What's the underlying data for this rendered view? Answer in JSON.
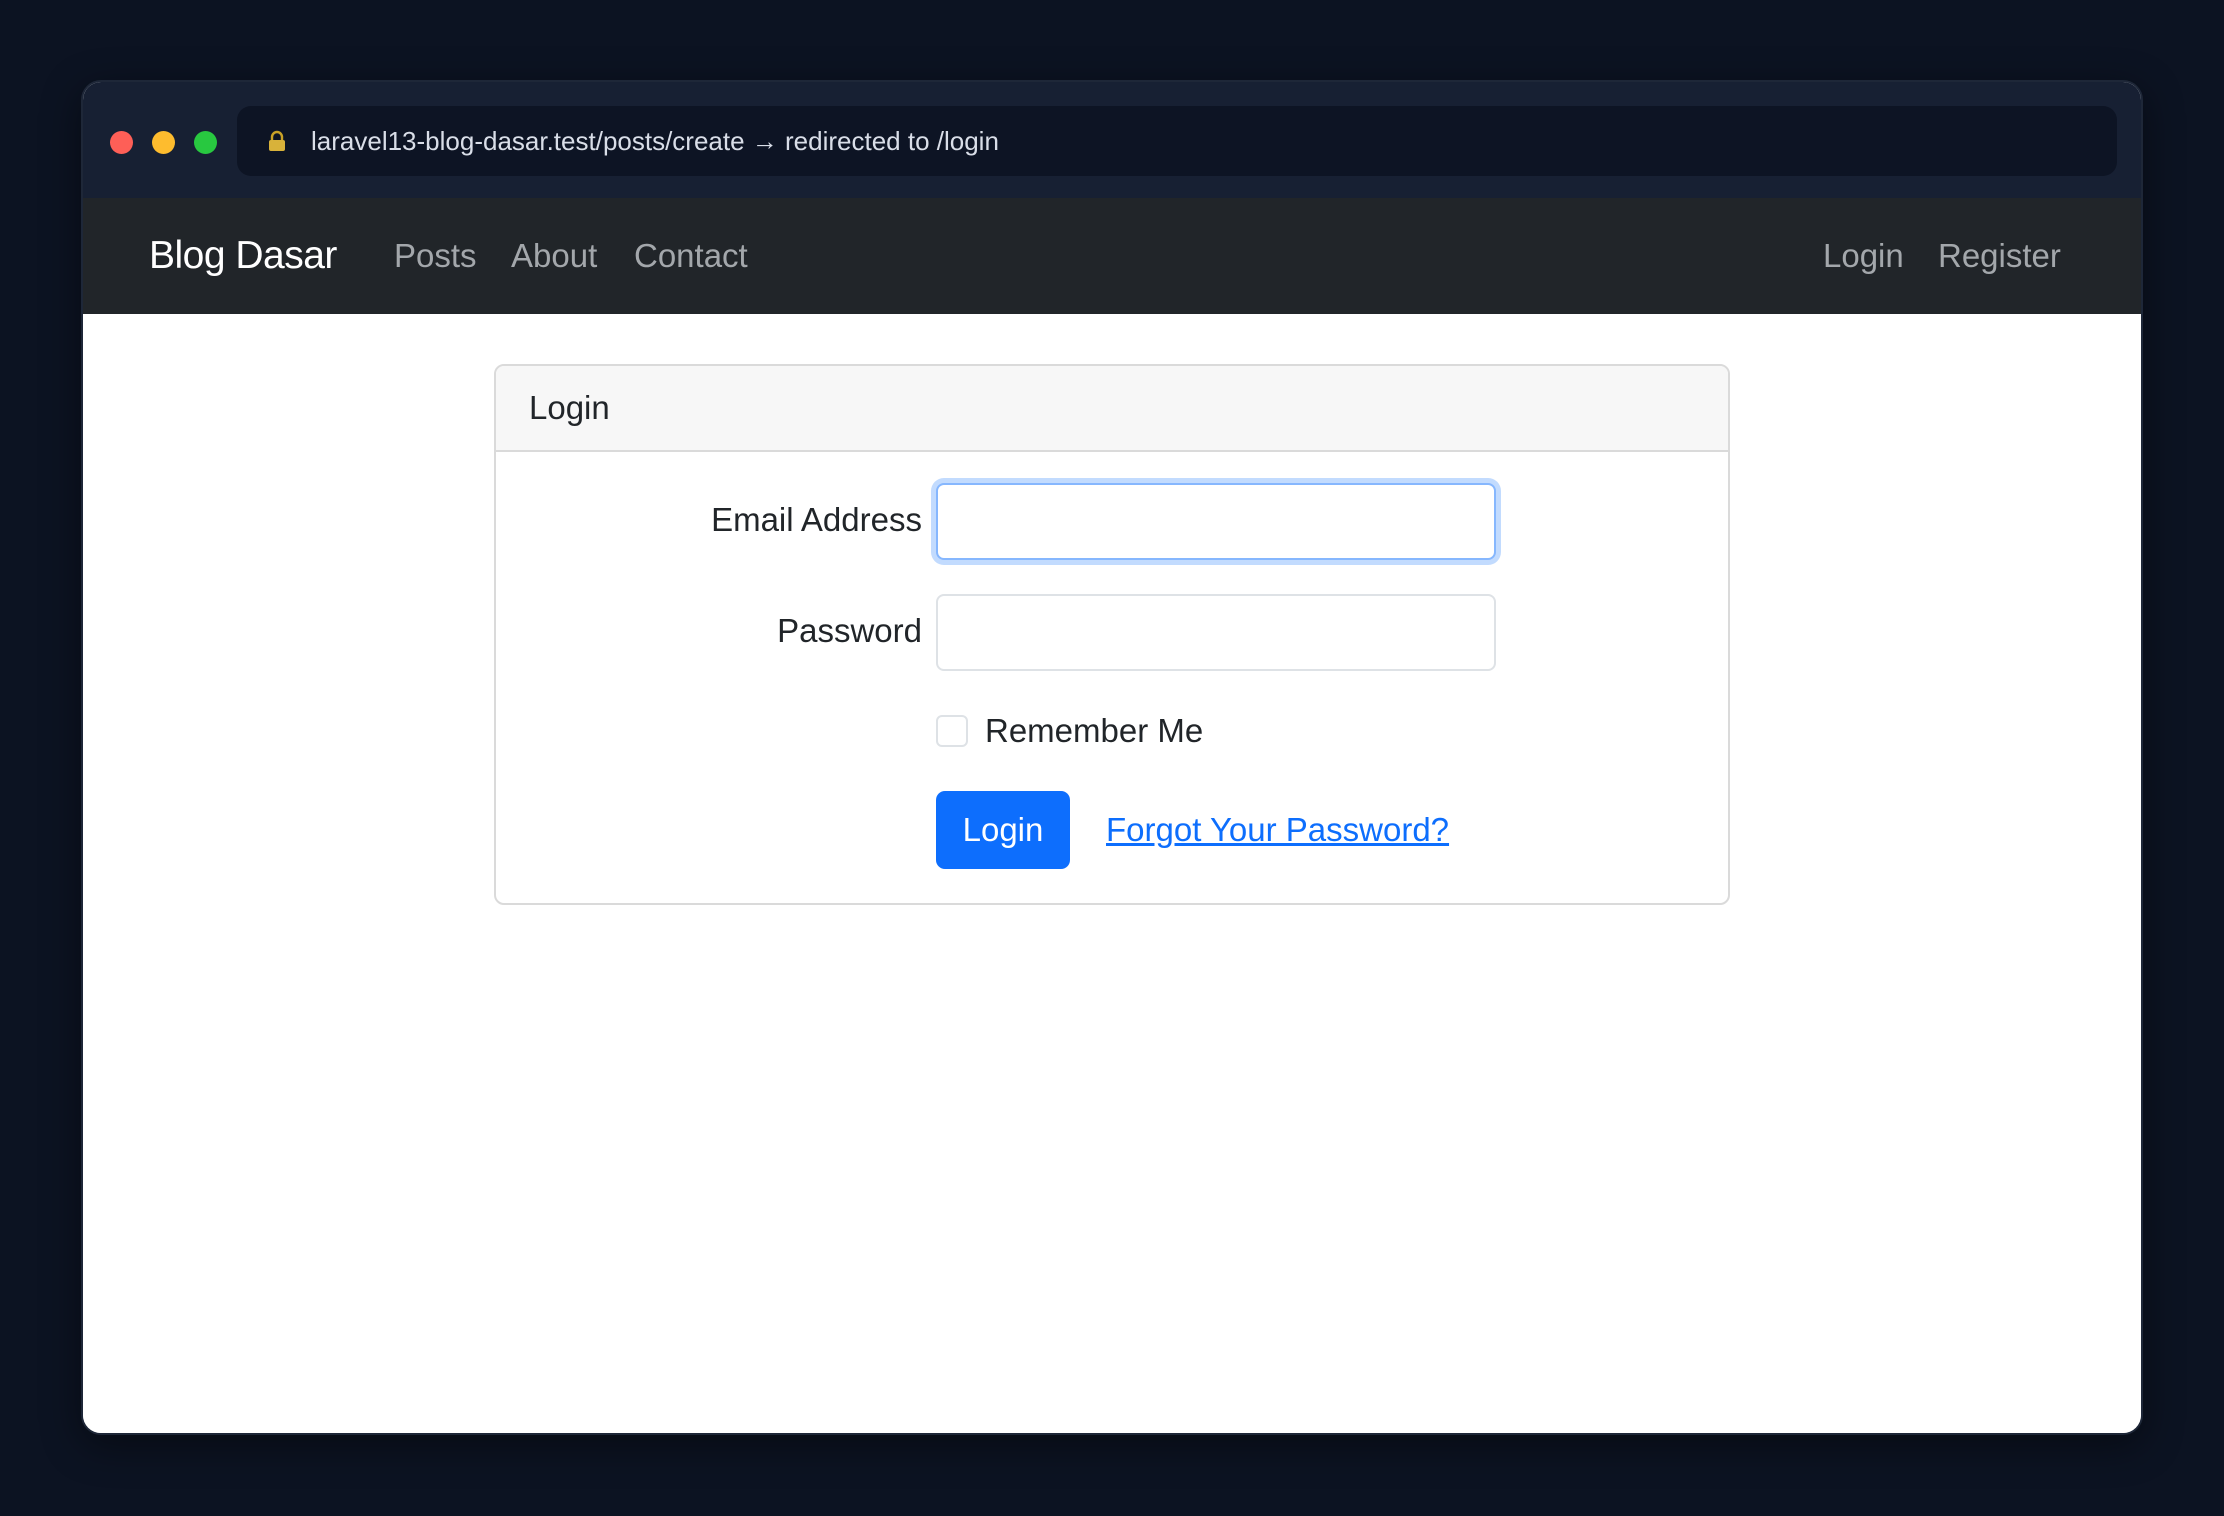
{
  "browser": {
    "url": "laravel13-blog-dasar.test/posts/create → redirected to /login"
  },
  "navbar": {
    "brand": "Blog Dasar",
    "links": [
      "Posts",
      "About",
      "Contact"
    ],
    "auth_links": [
      "Login",
      "Register"
    ]
  },
  "login_card": {
    "header": "Login",
    "email_label": "Email Address",
    "email_value": "",
    "password_label": "Password",
    "password_value": "",
    "remember_label": "Remember Me",
    "remember_checked": false,
    "submit_label": "Login",
    "forgot_label": "Forgot Your Password?"
  },
  "colors": {
    "primary": "#0d6efd",
    "navbar_bg": "#212529",
    "page_bg": "#0c1322"
  }
}
